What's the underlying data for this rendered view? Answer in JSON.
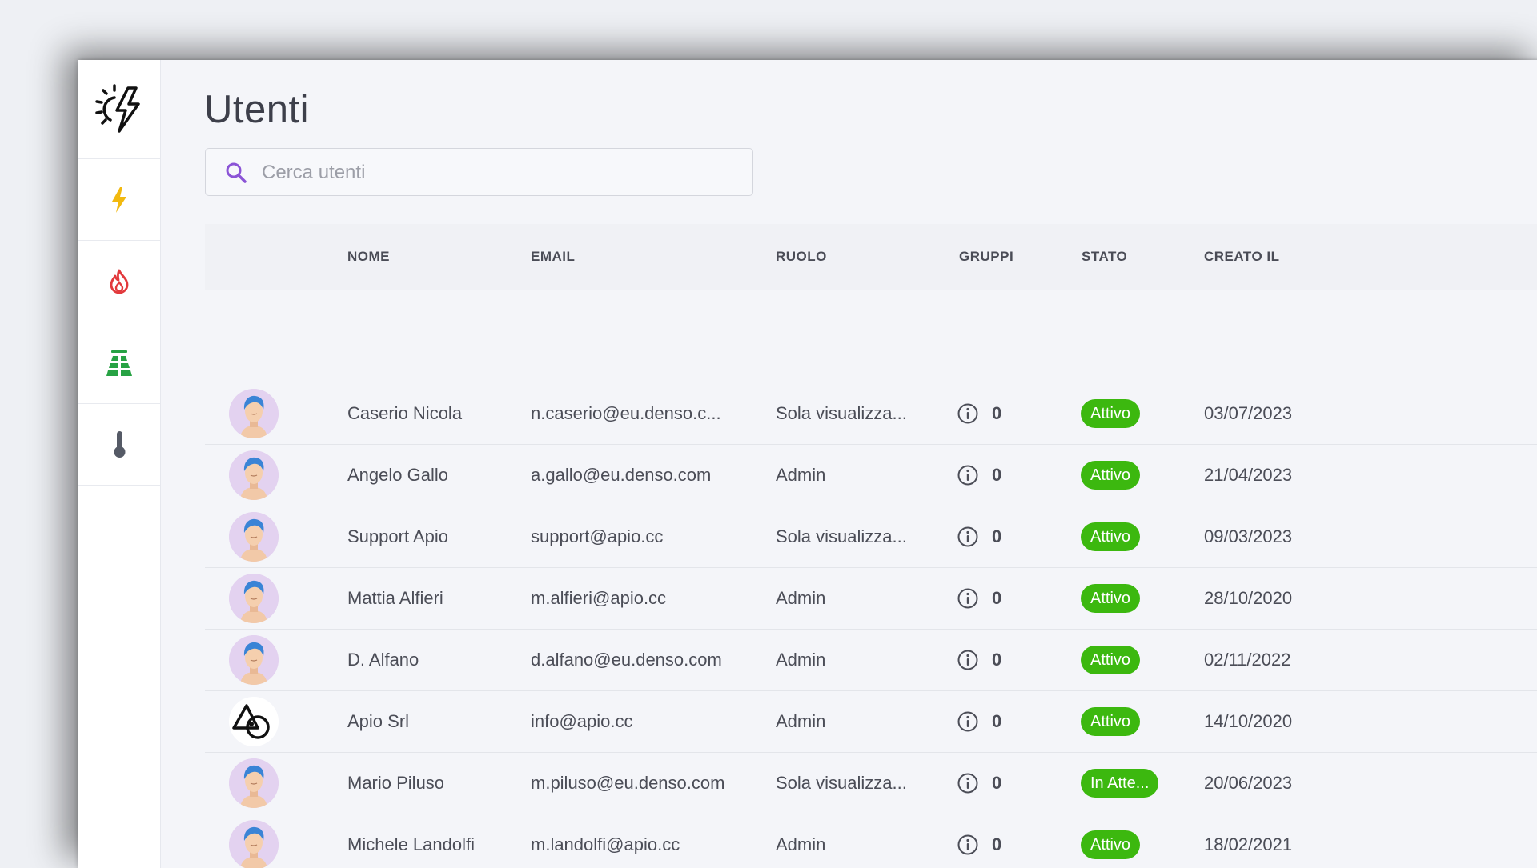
{
  "page": {
    "title": "Utenti",
    "search_placeholder": "Cerca utenti"
  },
  "sidebar": {
    "items": [
      {
        "name": "bolt",
        "color": "#f2b90f"
      },
      {
        "name": "flame",
        "color": "#e2393c"
      },
      {
        "name": "solar-panel",
        "color": "#27a244"
      },
      {
        "name": "thermometer",
        "color": "#555a66"
      }
    ]
  },
  "table": {
    "headers": {
      "nome": "NOME",
      "email": "EMAIL",
      "ruolo": "RUOLO",
      "gruppi": "GRUPPI",
      "stato": "STATO",
      "creato_il": "CREATO IL"
    },
    "rows": [
      {
        "nome": "Caserio Nicola",
        "email": "n.caserio@eu.denso.c...",
        "ruolo": "Sola visualizza...",
        "gruppi": "0",
        "stato": "Attivo",
        "creato_il": "03/07/2023",
        "avatar": "person"
      },
      {
        "nome": "Angelo Gallo",
        "email": "a.gallo@eu.denso.com",
        "ruolo": "Admin",
        "gruppi": "0",
        "stato": "Attivo",
        "creato_il": "21/04/2023",
        "avatar": "person"
      },
      {
        "nome": "Support Apio",
        "email": "support@apio.cc",
        "ruolo": "Sola visualizza...",
        "gruppi": "0",
        "stato": "Attivo",
        "creato_il": "09/03/2023",
        "avatar": "person"
      },
      {
        "nome": "Mattia Alfieri",
        "email": "m.alfieri@apio.cc",
        "ruolo": "Admin",
        "gruppi": "0",
        "stato": "Attivo",
        "creato_il": "28/10/2020",
        "avatar": "person"
      },
      {
        "nome": "D. Alfano",
        "email": "d.alfano@eu.denso.com",
        "ruolo": "Admin",
        "gruppi": "0",
        "stato": "Attivo",
        "creato_il": "02/11/2022",
        "avatar": "person"
      },
      {
        "nome": "Apio Srl",
        "email": "info@apio.cc",
        "ruolo": "Admin",
        "gruppi": "0",
        "stato": "Attivo",
        "creato_il": "14/10/2020",
        "avatar": "apio-logo"
      },
      {
        "nome": "Mario Piluso",
        "email": "m.piluso@eu.denso.com",
        "ruolo": "Sola visualizza...",
        "gruppi": "0",
        "stato": "In Atte...",
        "creato_il": "20/06/2023",
        "avatar": "person"
      },
      {
        "nome": "Michele Landolfi",
        "email": "m.landolfi@apio.cc",
        "ruolo": "Admin",
        "gruppi": "0",
        "stato": "Attivo",
        "creato_il": "18/02/2021",
        "avatar": "person"
      }
    ]
  },
  "colors": {
    "status_active": "#3cb80f",
    "search_icon": "#8b54d6"
  }
}
